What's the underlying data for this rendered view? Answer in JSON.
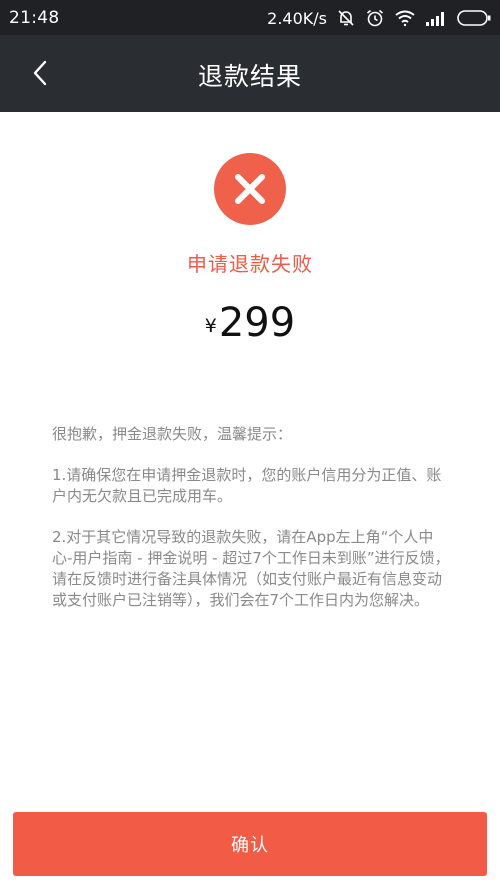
{
  "status_bar": {
    "time": "21:48",
    "net_speed": "2.40K/s",
    "icons": [
      "bell-off-icon",
      "alarm-icon",
      "wifi-icon",
      "signal-icon",
      "battery-icon"
    ]
  },
  "header": {
    "title": "退款结果",
    "back_icon": "chevron-left-icon"
  },
  "result": {
    "icon": "close-x-icon",
    "status_text": "申请退款失败",
    "status_color": "#ef5b44",
    "currency": "¥",
    "amount": "299"
  },
  "notice": {
    "intro": "很抱歉，押金退款失败，温馨提示：",
    "item1": "1.请确保您在申请押金退款时，您的账户信用分为正值、账户内无欠款且已完成用车。",
    "item2": "2.对于其它情况导致的退款失败，请在App左上角“个人中心-用户指南 - 押金说明 - 超过7个工作日未到账”进行反馈，请在反馈时进行备注具体情况（如支付账户最近有信息变动或支付账户已注销等），我们会在7个工作日内为您解决。"
  },
  "footer": {
    "confirm_label": "确认",
    "button_color": "#f25b45"
  }
}
